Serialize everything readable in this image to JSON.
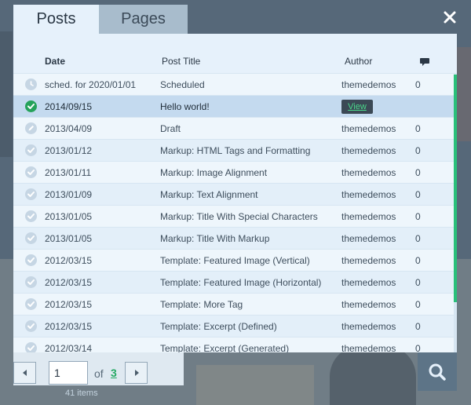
{
  "tabs": [
    {
      "label": "Posts",
      "active": true
    },
    {
      "label": "Pages",
      "active": false
    }
  ],
  "table": {
    "headers": {
      "date": "Date",
      "title": "Post Title",
      "author": "Author",
      "comments_icon": "speech-bubble-icon"
    },
    "rows": [
      {
        "status": "scheduled",
        "icon": "clock-icon",
        "date": "sched. for 2020/01/01",
        "title": "Scheduled",
        "author": "themedemos",
        "comments": "0"
      },
      {
        "status": "published",
        "icon": "check-icon",
        "date": "2014/09/15",
        "title": "Hello world!",
        "author": "",
        "comments": "",
        "selected": true
      },
      {
        "status": "draft",
        "icon": "pencil-icon",
        "date": "2013/04/09",
        "title": "Draft",
        "author": "themedemos",
        "comments": "0"
      },
      {
        "status": "published",
        "icon": "check-icon",
        "date": "2013/01/12",
        "title": "Markup: HTML Tags and Formatting",
        "author": "themedemos",
        "comments": "0"
      },
      {
        "status": "published",
        "icon": "check-icon",
        "date": "2013/01/11",
        "title": "Markup: Image Alignment",
        "author": "themedemos",
        "comments": "0"
      },
      {
        "status": "published",
        "icon": "check-icon",
        "date": "2013/01/09",
        "title": "Markup: Text Alignment",
        "author": "themedemos",
        "comments": "0"
      },
      {
        "status": "published",
        "icon": "check-icon",
        "date": "2013/01/05",
        "title": "Markup: Title With Special Characters",
        "author": "themedemos",
        "comments": "0"
      },
      {
        "status": "published",
        "icon": "check-icon",
        "date": "2013/01/05",
        "title": "Markup: Title With Markup",
        "author": "themedemos",
        "comments": "0"
      },
      {
        "status": "published",
        "icon": "check-icon",
        "date": "2012/03/15",
        "title": "Template: Featured Image (Vertical)",
        "author": "themedemos",
        "comments": "0"
      },
      {
        "status": "published",
        "icon": "check-icon",
        "date": "2012/03/15",
        "title": "Template: Featured Image (Horizontal)",
        "author": "themedemos",
        "comments": "0"
      },
      {
        "status": "published",
        "icon": "check-icon",
        "date": "2012/03/15",
        "title": "Template: More Tag",
        "author": "themedemos",
        "comments": "0"
      },
      {
        "status": "published",
        "icon": "check-icon",
        "date": "2012/03/15",
        "title": "Template: Excerpt (Defined)",
        "author": "themedemos",
        "comments": "0"
      },
      {
        "status": "published",
        "icon": "check-icon",
        "date": "2012/03/14",
        "title": "Template: Excerpt (Generated)",
        "author": "themedemos",
        "comments": "0"
      }
    ],
    "view_label": "View"
  },
  "pagination": {
    "current_page": "1",
    "of_label": "of",
    "total_pages": "3",
    "items_count": "41 items"
  },
  "colors": {
    "accent_green": "#25a25a",
    "panel_bg": "#e6f1fb",
    "selected_row": "#c4daef"
  }
}
